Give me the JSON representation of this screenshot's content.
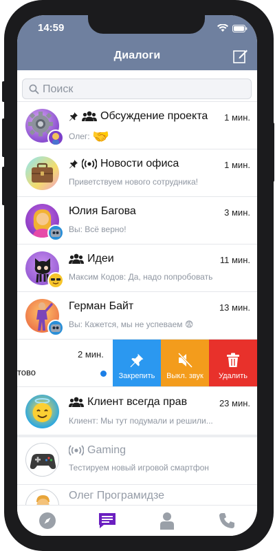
{
  "status": {
    "time": "14:59"
  },
  "header": {
    "title": "Диалоги",
    "compose_icon": "compose-icon"
  },
  "search": {
    "placeholder": "Поиск"
  },
  "dialogs": [
    {
      "title": "Обсуждение проекта",
      "time": "1 мин.",
      "sender": "Олег:",
      "preview": "🤝",
      "pinned": true,
      "group": true
    },
    {
      "title": "Новости офиса",
      "time": "1 мин.",
      "preview": "Приветствуем нового сотрудника!",
      "pinned": true,
      "channel": true
    },
    {
      "title": "Юлия Багова",
      "time": "3 мин.",
      "preview": "Вы: Всё верно!"
    },
    {
      "title": "Идеи",
      "time": "11 мин.",
      "preview": "Максим Кодов: Да, надо попробовать",
      "group": true
    },
    {
      "title": "Герман Байт",
      "time": "13 мин.",
      "preview": "Вы: Кажется, мы не успеваем 😨"
    },
    {
      "title_fragment": "тово",
      "time": "2 мин.",
      "unread_dot": true
    },
    {
      "title": "Клиент всегда прав",
      "time": "23 мин.",
      "preview": "Клиент: Мы тут подумали и решили...",
      "group": true
    },
    {
      "title": "Gaming",
      "time": "",
      "preview": "Тестируем новый игровой смартфон",
      "channel": true,
      "muted": true
    },
    {
      "title": "Олег Програмидзе",
      "time": "",
      "preview": ""
    }
  ],
  "swipe_actions": {
    "pin": "Закрепить",
    "mute": "Выкл. звук",
    "delete": "Удалить"
  },
  "tabbar": [
    "compass-icon",
    "chat-icon",
    "contacts-icon",
    "phone-icon"
  ],
  "colors": {
    "header": "#6f809f",
    "pin": "#2b98f0",
    "mute": "#f39c1c",
    "delete": "#e8312b",
    "active_tab": "#6b1fc0"
  }
}
